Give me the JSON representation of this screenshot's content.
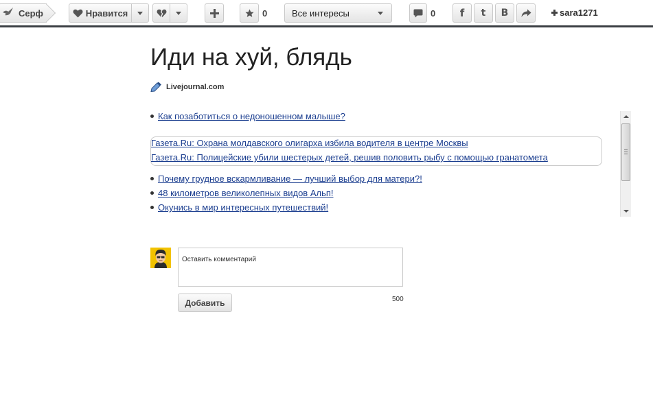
{
  "toolbar": {
    "serf_label": "Серф",
    "like_label": "Нравится",
    "star_count": "0",
    "interests_label": "Все интересы",
    "comment_count": "0",
    "username": "sara1271"
  },
  "post": {
    "title": "Иди на хуй, блядь",
    "source": "Livejournal.com"
  },
  "links": {
    "top": "Как позаботиться о недоношенном малыше?",
    "news": [
      "Газета.Ru: Охрана молдавского олигарха избила водителя в центре Москвы",
      "Газета.Ru: Полицейские убили шестерых детей, решив половить рыбу с помощью гранатомета"
    ],
    "bottom": [
      "Почему грудное вскармливание — лучший выбор для матери?!",
      "48 километров великолепных видов Альп!",
      "Окунись в мир интересных путешествий!"
    ]
  },
  "comment": {
    "placeholder": "Оставить комментарий",
    "submit_label": "Добавить",
    "char_limit": "500"
  },
  "colors": {
    "link": "#1a3d8f",
    "toolbar_border": "#3b3f44",
    "avatar_bg": "#f2c200"
  },
  "icons": [
    "bird-icon",
    "heart-icon",
    "broken-heart-icon",
    "plus-icon",
    "star-icon",
    "chevron-down-icon",
    "comment-icon",
    "facebook-icon",
    "twitter-icon",
    "vk-icon",
    "share-icon",
    "pencil-icon"
  ]
}
